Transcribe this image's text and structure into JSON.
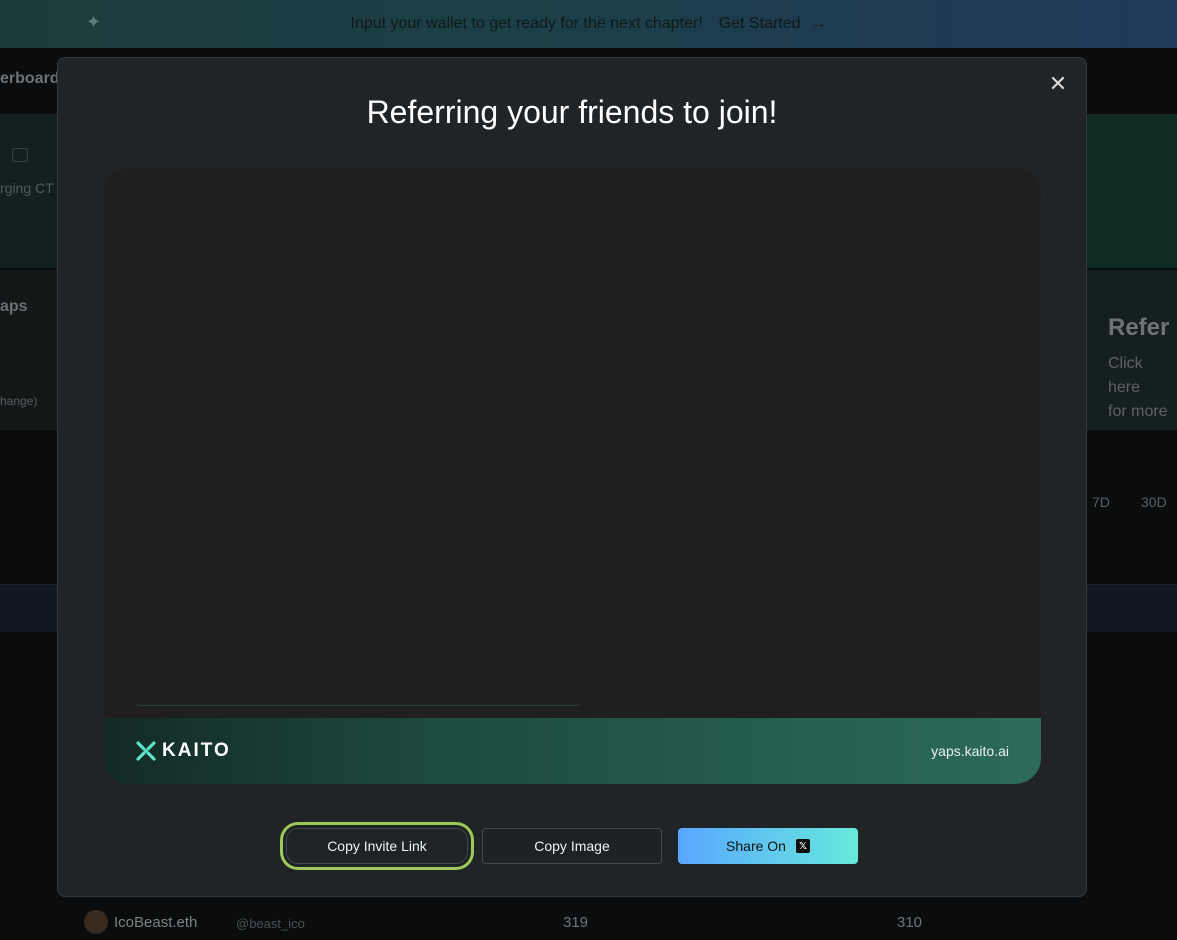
{
  "banner": {
    "message": "Input your wallet to get ready for the next chapter!",
    "cta_label": "Get Started"
  },
  "background": {
    "nav_title": "erboard",
    "ct_label": "rging CT",
    "yaps_label": "aps",
    "change_label": "hange)",
    "refer_title": "Refer",
    "refer_text_1": "Click here",
    "refer_text_2": "for more",
    "period_7d": "7D",
    "period_30d": "30D",
    "row": {
      "name": "IcoBeast.eth",
      "handle": "@beast_ico",
      "value_1": "319",
      "value_2": "310"
    }
  },
  "modal": {
    "title": "Referring your friends to join!",
    "card": {
      "logo_text": "KAITO",
      "domain": "yaps.kaito.ai"
    },
    "buttons": {
      "copy_invite": "Copy Invite Link",
      "copy_image": "Copy Image",
      "share_on": "Share On"
    }
  },
  "colors": {
    "accent_green": "#9dc85a",
    "share_gradient_start": "#5aa7ff",
    "share_gradient_end": "#66e9db"
  }
}
